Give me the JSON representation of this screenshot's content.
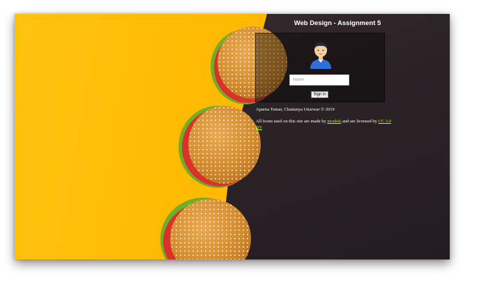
{
  "page": {
    "title": "Web Design - Assignment 5"
  },
  "login": {
    "name_placeholder": "Name",
    "signin_label": "Sign in"
  },
  "footer": {
    "copyright": "Aparna Tomar, Chaitanya Uttarwar © 2019",
    "credit_prefix": "All Icons used on this site are made by",
    "author_link": "monkik",
    "credit_middle": "and are licensed by",
    "license_link": "CC 3.0 BY"
  },
  "colors": {
    "background_left": "#ffc20e",
    "background_right": "#2c2327",
    "link": "#b6ff00",
    "title_text": "#ffffff"
  },
  "icons": {
    "avatar": "user-avatar-icon"
  }
}
